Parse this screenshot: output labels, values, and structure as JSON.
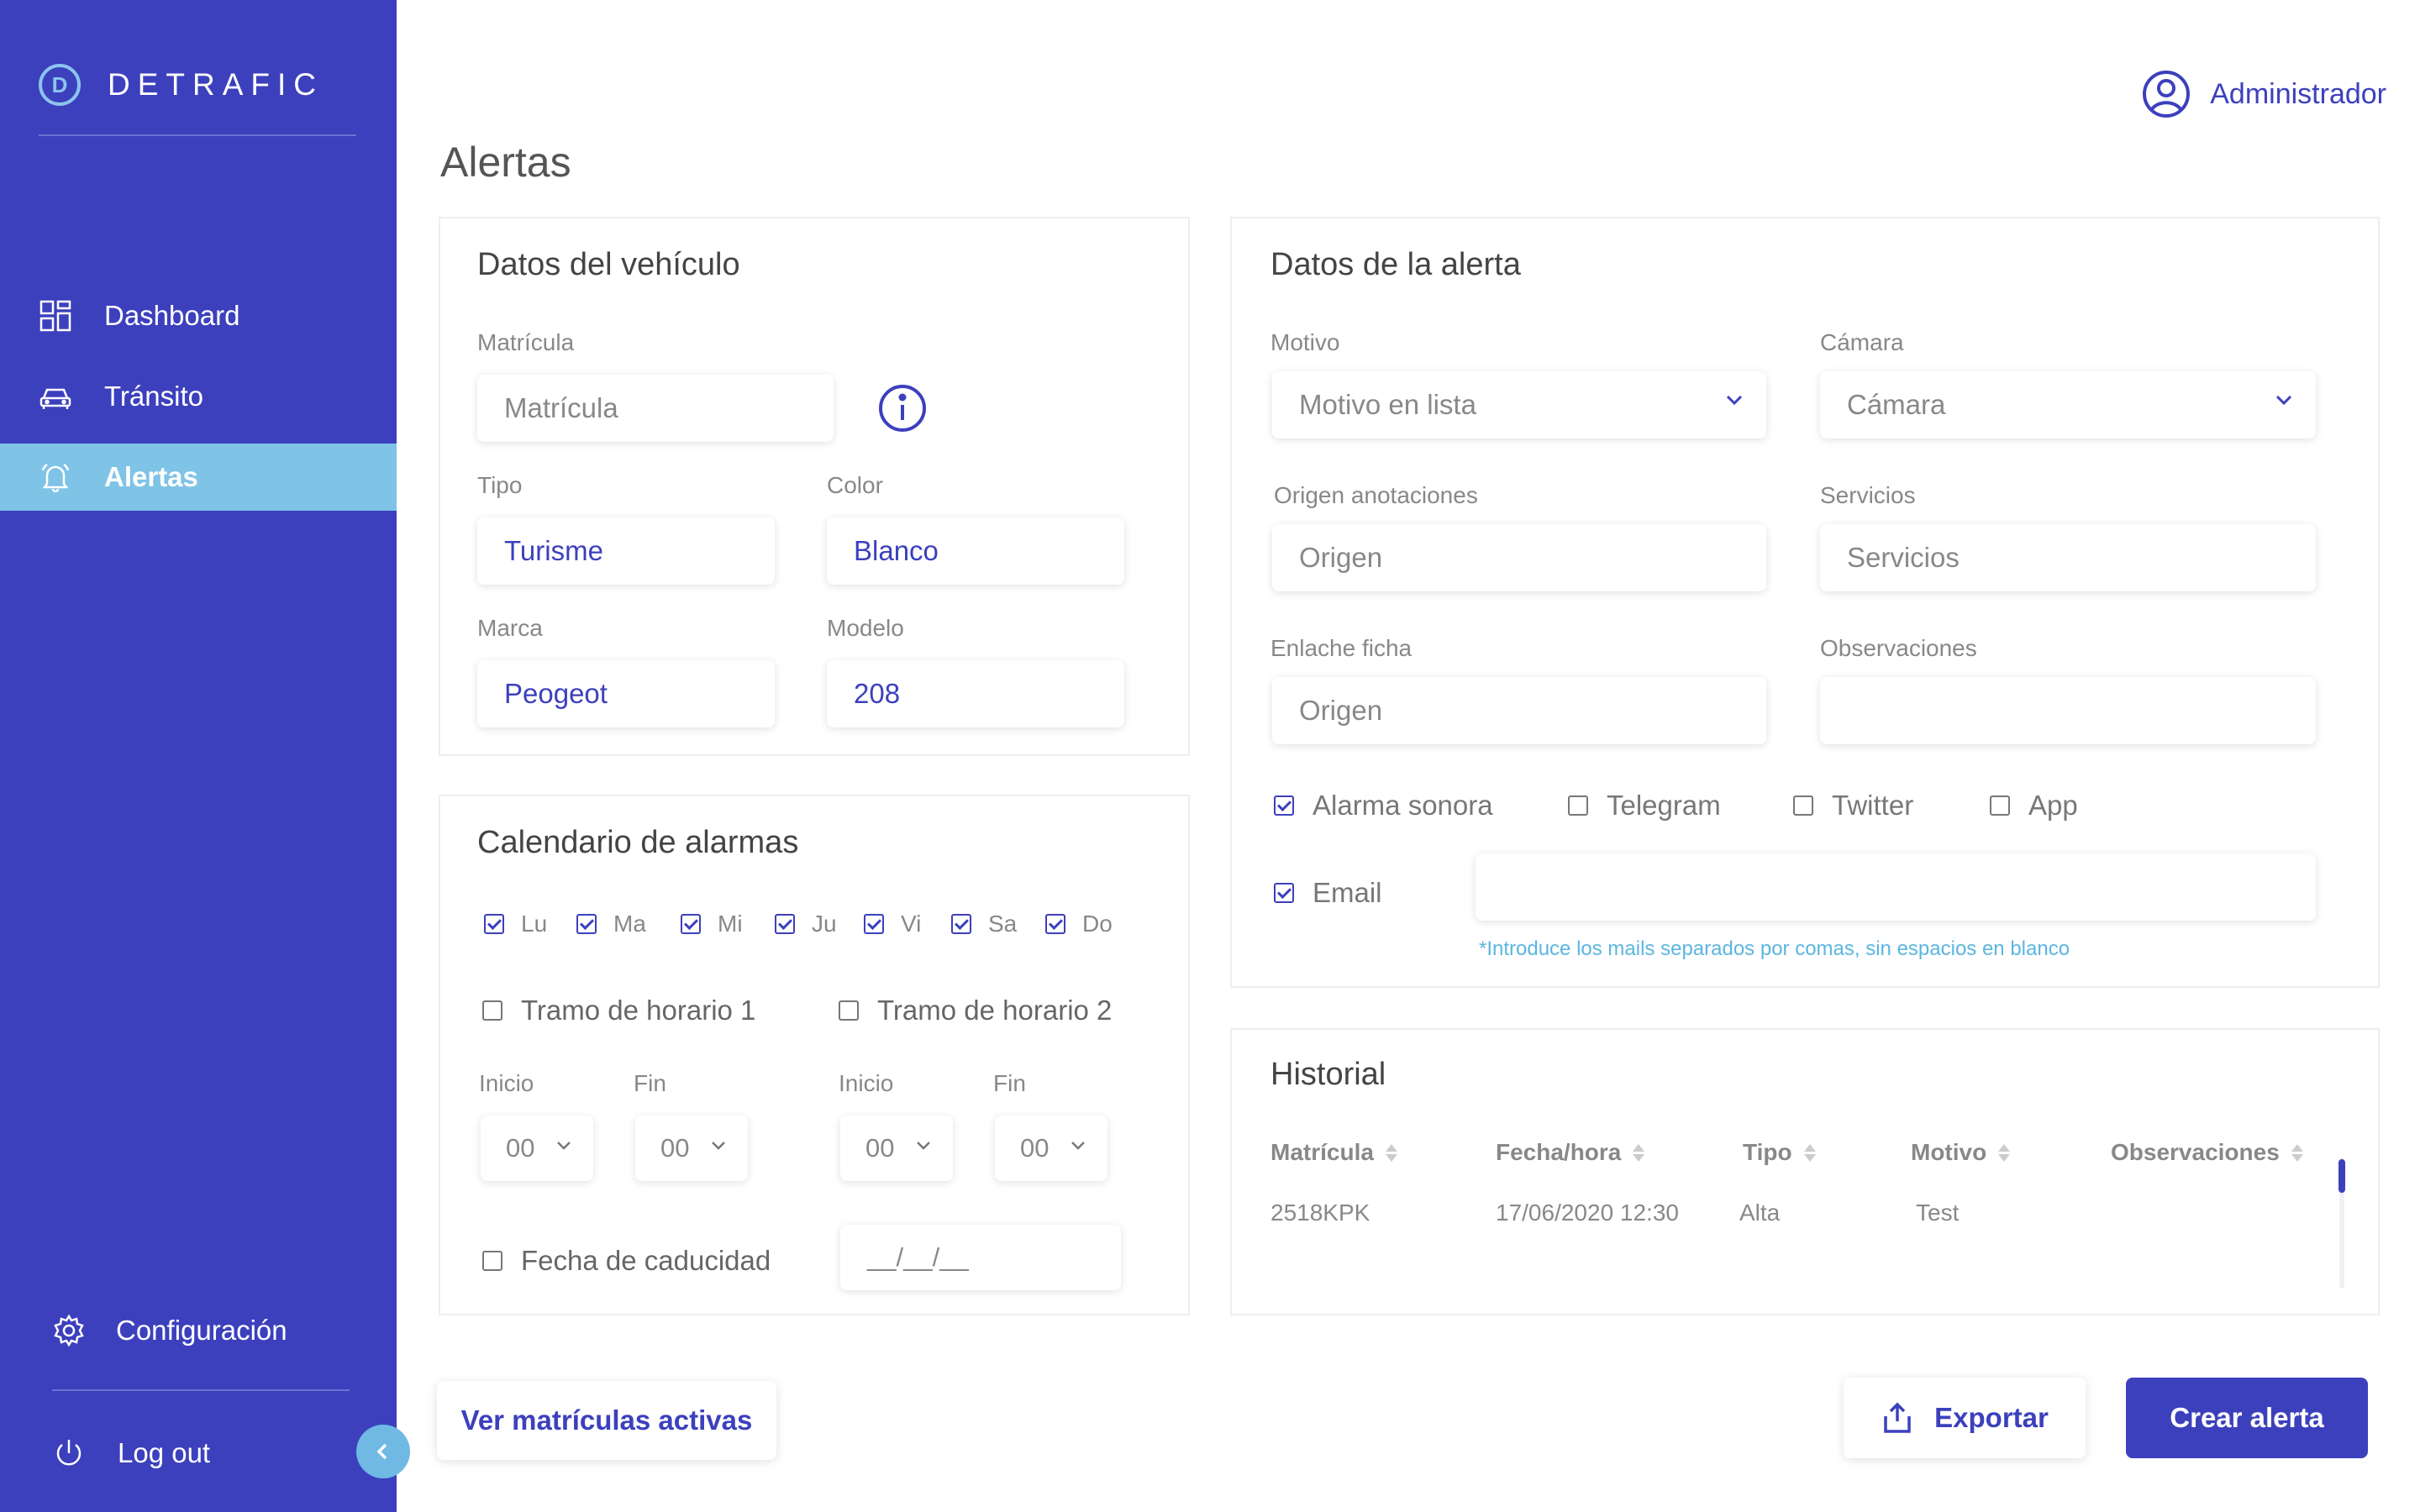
{
  "app": {
    "brand": "DETRAFIC",
    "brand_letter": "D",
    "accent": "#3c40bd",
    "sidebar_active": "#7fc3e6"
  },
  "sidebar": {
    "items": [
      {
        "label": "Dashboard",
        "icon": "dashboard-icon"
      },
      {
        "label": "Tránsito",
        "icon": "car-icon"
      },
      {
        "label": "Alertas",
        "icon": "bell-icon",
        "active": true
      }
    ],
    "config_label": "Configuración",
    "logout_label": "Log out"
  },
  "header": {
    "user": "Administrador",
    "title": "Alertas"
  },
  "vehicle": {
    "title": "Datos del vehículo",
    "plate_label": "Matrícula",
    "plate_placeholder": "Matrícula",
    "type_label": "Tipo",
    "type_value": "Turisme",
    "color_label": "Color",
    "color_value": "Blanco",
    "brand_label": "Marca",
    "brand_value": "Peogeot",
    "model_label": "Modelo",
    "model_value": "208"
  },
  "calendar": {
    "title": "Calendario de alarmas",
    "days": [
      "Lu",
      "Ma",
      "Mi",
      "Ju",
      "Vi",
      "Sa",
      "Do"
    ],
    "slot1": "Tramo de horario 1",
    "slot2": "Tramo de horario 2",
    "start_label": "Inicio",
    "end_label": "Fin",
    "time_value": "00",
    "expiry_label": "Fecha de caducidad",
    "expiry_placeholder": "__/__/__"
  },
  "alert": {
    "title": "Datos de la alerta",
    "motivo_label": "Motivo",
    "motivo_value": "Motivo en lista",
    "camara_label": "Cámara",
    "camara_value": "Cámara",
    "origen_label": "Origen anotaciones",
    "origen_placeholder": "Origen",
    "servicios_label": "Servicios",
    "servicios_placeholder": "Servicios",
    "enlace_label": "Enlache ficha",
    "enlace_placeholder": "Origen",
    "obs_label": "Observaciones",
    "alarma_sonora": "Alarma sonora",
    "telegram": "Telegram",
    "twitter": "Twitter",
    "app": "App",
    "email": "Email",
    "email_hint": "*Introduce los mails separados por comas, sin espacios en blanco"
  },
  "history": {
    "title": "Historial",
    "columns": [
      "Matrícula",
      "Fecha/hora",
      "Tipo",
      "Motivo",
      "Observaciones"
    ],
    "rows": [
      {
        "plate": "2518KPK",
        "datetime": "17/06/2020 12:30",
        "type": "Alta",
        "reason": "Test",
        "notes": ""
      }
    ]
  },
  "actions": {
    "active_plates": "Ver matrículas activas",
    "export": "Exportar",
    "create": "Crear alerta"
  }
}
